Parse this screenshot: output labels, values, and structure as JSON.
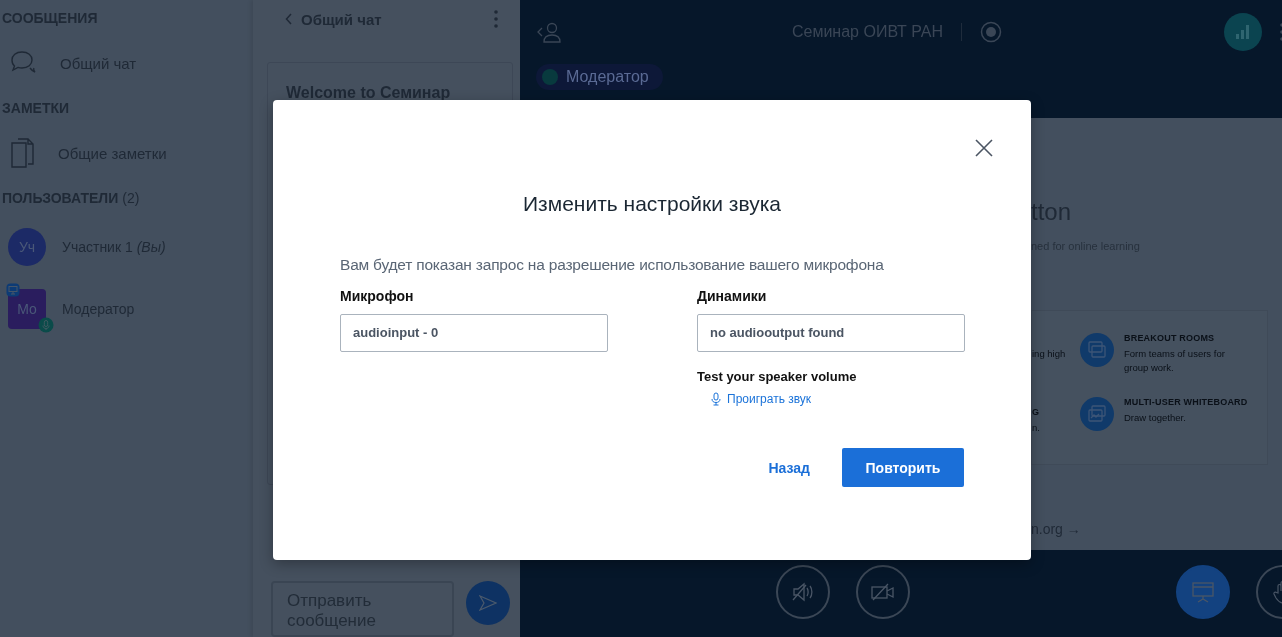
{
  "sidebar": {
    "sections": [
      {
        "title": "СООБЩЕНИЯ",
        "items": [
          {
            "label": "Общий чат",
            "kind": "chat"
          }
        ]
      },
      {
        "title": "ЗАМЕТКИ",
        "items": [
          {
            "label": "Общие заметки",
            "kind": "notes"
          }
        ]
      }
    ],
    "users_title": "ПОЛЬЗОВАТЕЛИ",
    "users_count": "(2)",
    "users": [
      {
        "initials": "Уч",
        "name": "Участник 1 *(Вы)*",
        "kind": "viewer",
        "color": "#1c2a66",
        "presenter": false,
        "mic": false
      },
      {
        "initials": "Мо",
        "name": "Модератор",
        "kind": "moderator",
        "color": "#2a1d5e",
        "presenter": true,
        "mic": true
      }
    ]
  },
  "chat": {
    "title": "Общий чат",
    "welcome": "Welcome to Семинар",
    "placeholder": "Отправить сообщение"
  },
  "meeting": {
    "title": "Семинар ОИВТ РАН",
    "role": "Модератор",
    "recording": false
  },
  "slide": {
    "heading": "tton",
    "subtitle": "ned for online learning",
    "features": [
      {
        "text": "ing high",
        "kind": "none"
      },
      {
        "title": "BREAKOUT ROOMS",
        "text": "Form teams of users for group work.",
        "kind": "rooms"
      },
      {
        "title": "G",
        "text": "n.",
        "kind": "none"
      },
      {
        "title": "MULTI-USER WHITEBOARD",
        "text": "Draw together.",
        "kind": "whiteboard"
      }
    ],
    "link": "n.org →"
  },
  "controls": [
    {
      "kind": "audio",
      "active": false
    },
    {
      "kind": "video",
      "active": false
    },
    {
      "kind": "presentation",
      "active": true
    },
    {
      "kind": "hand",
      "active": false
    }
  ],
  "modal": {
    "title": "Изменить настройки звука",
    "description": "Вам будет показан запрос на разрешение использование вашего микрофона",
    "microphone_label": "Микрофон",
    "microphone_value": "audioinput - 0",
    "speakers_label": "Динамики",
    "speakers_value": "no audiooutput found",
    "test_label": "Test your speaker volume",
    "play_link": "Проиграть звук",
    "back_button": "Назад",
    "retry_button": "Повторить"
  }
}
